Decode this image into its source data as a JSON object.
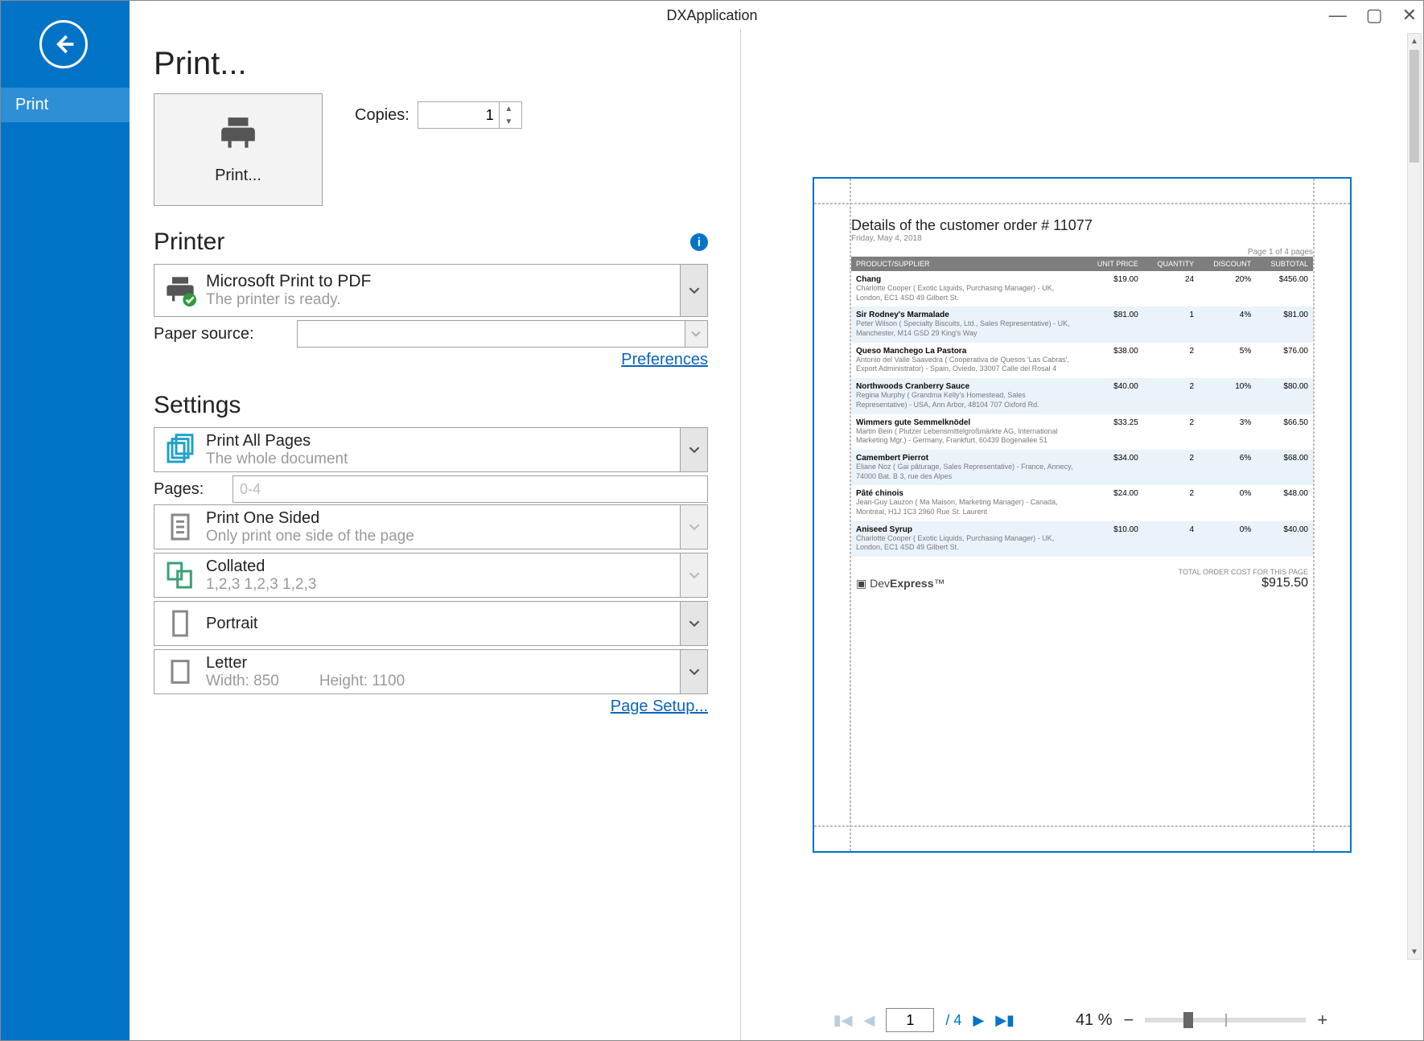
{
  "titlebar": {
    "title": "DXApplication",
    "minimize": "—",
    "maximize": "▢",
    "close": "✕"
  },
  "sidebar": {
    "nav_print": "Print"
  },
  "print": {
    "page_title": "Print...",
    "print_button": "Print...",
    "copies_label": "Copies:",
    "copies_value": "1"
  },
  "printer_section": {
    "title": "Printer",
    "selected": "Microsoft Print to PDF",
    "status": "The printer is ready.",
    "paper_source_label": "Paper source:",
    "paper_source_value": "",
    "preferences_link": "Preferences"
  },
  "settings_section": {
    "title": "Settings",
    "range": {
      "l1": "Print All Pages",
      "l2": "The whole document"
    },
    "pages_label": "Pages:",
    "pages_placeholder": "0-4",
    "duplex": {
      "l1": "Print One Sided",
      "l2": "Only print one side of the page"
    },
    "collate": {
      "l1": "Collated",
      "l2": "1,2,3  1,2,3  1,2,3"
    },
    "orient": {
      "l1": "Portrait",
      "l2": ""
    },
    "paper": {
      "l1": "Letter",
      "l2a": "Width: 850",
      "l2b": "Height: 1100"
    },
    "page_setup_link": "Page Setup..."
  },
  "preview": {
    "nav": {
      "page_value": "1",
      "page_count": "/ 4",
      "zoom": "41 %"
    },
    "report": {
      "title": "Details of the customer order # 11077",
      "date": "Friday, May 4, 2018",
      "page_info": "Page 1 of 4 pages",
      "headers": {
        "product": "PRODUCT/SUPPLIER",
        "unit_price": "UNIT PRICE",
        "qty": "QUANTITY",
        "disc": "DISCOUNT",
        "subtotal": "SUBTOTAL"
      },
      "rows": [
        {
          "name": "Chang",
          "sup": "Charlotte Cooper ( Exotic Liquids, Purchasing Manager)  -  UK, London, EC1 4SD  49 Gilbert St.",
          "price": "$19.00",
          "qty": "24",
          "disc": "20%",
          "sub": "$456.00"
        },
        {
          "name": "Sir Rodney's Marmalade",
          "sup": "Peter Wilson ( Specialty Biscuits, Ltd., Sales Representative)  -  UK, Manchester, M14 GSD  29 King's Way",
          "price": "$81.00",
          "qty": "1",
          "disc": "4%",
          "sub": "$81.00"
        },
        {
          "name": "Queso Manchego La Pastora",
          "sup": "Antonio del Valle Saavedra ( Cooperativa de Quesos 'Las Cabras', Export Administrator)  -  Spain, Oviedo, 33007  Calle del Rosal 4",
          "price": "$38.00",
          "qty": "2",
          "disc": "5%",
          "sub": "$76.00"
        },
        {
          "name": "Northwoods Cranberry Sauce",
          "sup": "Regina Murphy ( Grandma Kelly's Homestead, Sales Representative)  -  USA, Ann Arbor, 48104  707 Oxford Rd.",
          "price": "$40.00",
          "qty": "2",
          "disc": "10%",
          "sub": "$80.00"
        },
        {
          "name": "Wimmers gute Semmelknödel",
          "sup": "Martin Bein ( Plutzer Lebensmittelgroßmärkte AG, International Marketing Mgr.)  -  Germany, Frankfurt, 60439  Bogenallee 51",
          "price": "$33.25",
          "qty": "2",
          "disc": "3%",
          "sub": "$66.50"
        },
        {
          "name": "Camembert Pierrot",
          "sup": "Eliane Noz ( Gai pâturage, Sales Representative)  -  France, Annecy, 74000  Bat. B 3, rue des Alpes",
          "price": "$34.00",
          "qty": "2",
          "disc": "6%",
          "sub": "$68.00"
        },
        {
          "name": "Pâté chinois",
          "sup": "Jean-Guy Lauzon ( Ma Maison, Marketing Manager)  -  Canada, Montréal, H1J 1C3  2960 Rue St. Laurent",
          "price": "$24.00",
          "qty": "2",
          "disc": "0%",
          "sub": "$48.00"
        },
        {
          "name": "Aniseed Syrup",
          "sup": "Charlotte Cooper ( Exotic Liquids, Purchasing Manager)  -  UK, London, EC1 4SD  49 Gilbert St.",
          "price": "$10.00",
          "qty": "4",
          "disc": "0%",
          "sub": "$40.00"
        }
      ],
      "total_label": "TOTAL ORDER COST FOR THIS PAGE",
      "total_value": "$915.50",
      "logo": "DevExpress"
    }
  }
}
